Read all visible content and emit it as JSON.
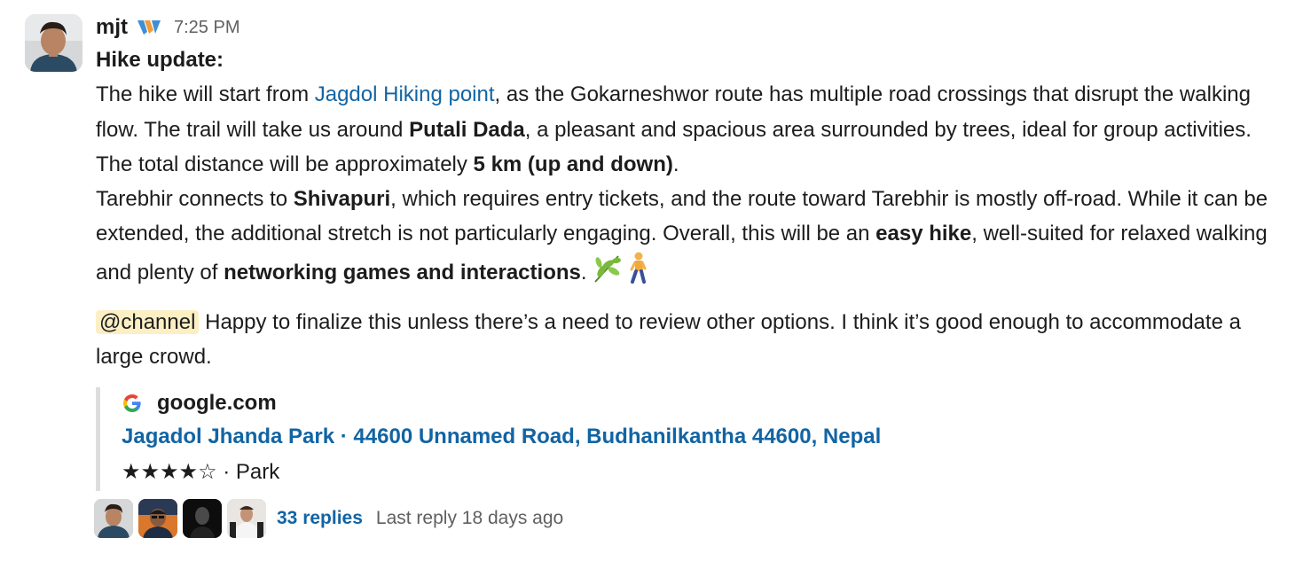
{
  "message": {
    "username": "mjt",
    "timestamp": "7:25 PM",
    "title": "Hike update:",
    "para1": {
      "t1": "The hike will start from ",
      "link1": "Jagdol Hiking point",
      "t2": ", as the Gokarneshwor route has multiple road crossings that disrupt the walking flow. The trail will take us around ",
      "b1": "Putali Dada",
      "t3": ", a pleasant and spacious area surrounded by trees, ideal for group activities. The total distance will be approximately ",
      "b2": "5 km (up and down)",
      "t4": "."
    },
    "para2": {
      "t1": " Tarebhir connects to ",
      "b1": "Shivapuri",
      "t2": ", which requires entry tickets, and the route toward Tarebhir is mostly off-road. While it can be extended, the additional stretch is not particularly engaging. Overall, this will be an ",
      "b2": "easy hike",
      "t3": ", well-suited for relaxed walking and plenty of ",
      "b3": "networking games and interactions",
      "t4": ".",
      "emoji1": "herb-emoji",
      "emoji2": "person-walking-emoji"
    },
    "mention_para": {
      "mention": "@channel",
      "text": " Happy to finalize this unless there’s a need to review other options. I think it’s good enough to accommodate a large crowd."
    }
  },
  "unfurl": {
    "site": "google.com",
    "title": "Jagadol Jhanda Park · 44600 Unnamed Road, Budhanilkantha 44600, Nepal",
    "rating_stars": "★★★★☆",
    "rating_value": 4,
    "rating_max": 5,
    "category": " · Park"
  },
  "thread": {
    "replies": "33 replies",
    "last_reply": "Last reply 18 days ago"
  },
  "colors": {
    "link": "#1264a3",
    "mention_bg": "#fcefc4",
    "muted": "#616061",
    "text": "#1d1c1d"
  }
}
